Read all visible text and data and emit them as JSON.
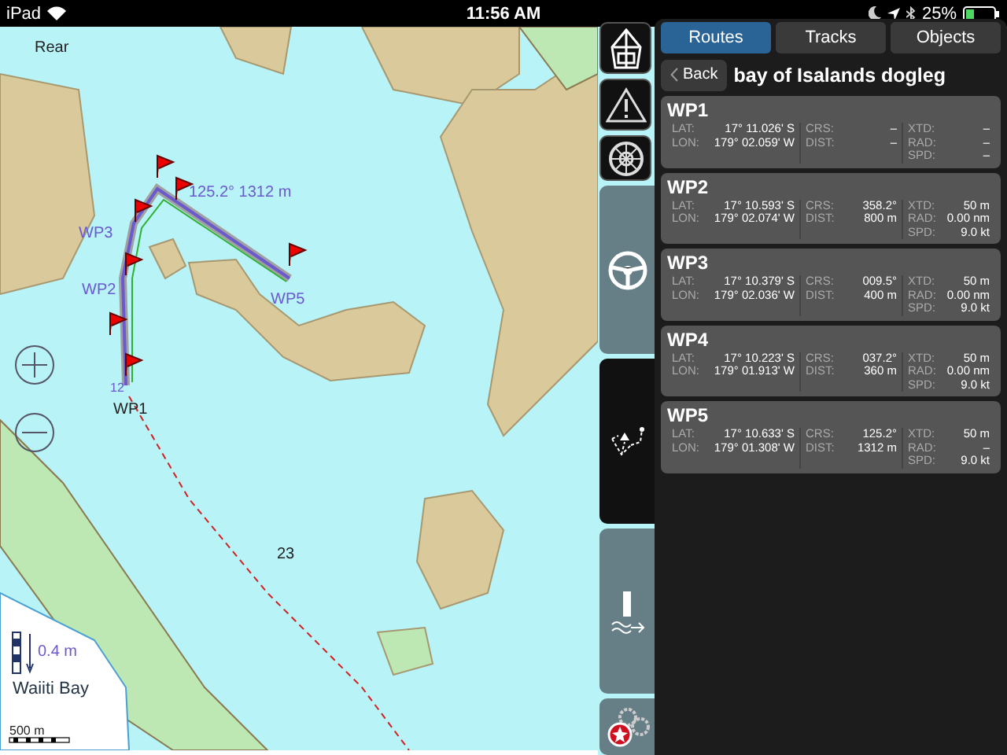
{
  "status_bar": {
    "device": "iPad",
    "time": "11:56 AM",
    "battery": "25%"
  },
  "map": {
    "labels": [
      "Rear",
      "125.2° 1312 m",
      "WP3",
      "WP2",
      "WP5",
      "12",
      "WP1",
      "23",
      "Waiiti Bay"
    ],
    "depth": "0.4 m",
    "scale": "500 m"
  },
  "toolbar": {
    "buttons": [
      {
        "kind": "ship",
        "selected": false
      },
      {
        "kind": "warning",
        "selected": false
      },
      {
        "kind": "wheel",
        "selected": false
      },
      {
        "kind": "helm",
        "selected": false
      },
      {
        "kind": "route",
        "selected": true
      },
      {
        "kind": "tide",
        "selected": false
      },
      {
        "kind": "settings",
        "selected": false
      }
    ]
  },
  "panel": {
    "tabs": [
      {
        "label": "Routes",
        "selected": true
      },
      {
        "label": "Tracks",
        "selected": false
      },
      {
        "label": "Objects",
        "selected": false
      }
    ],
    "back": "Back",
    "route_title": "bay of Isalands dogleg",
    "waypoints": [
      {
        "name": "WP1",
        "columns": [
          [
            {
              "label": "LAT:",
              "value": "17° 11.026' S"
            },
            {
              "label": "LON:",
              "value": "179° 02.059' W"
            }
          ],
          [
            {
              "label": "CRS:",
              "value": "–"
            },
            {
              "label": "DIST:",
              "value": "–"
            }
          ],
          [
            {
              "label": "XTD:",
              "value": "–"
            },
            {
              "label": "RAD:",
              "value": "–"
            },
            {
              "label": "SPD:",
              "value": "–"
            }
          ]
        ]
      },
      {
        "name": "WP2",
        "columns": [
          [
            {
              "label": "LAT:",
              "value": "17° 10.593' S"
            },
            {
              "label": "LON:",
              "value": "179° 02.074' W"
            }
          ],
          [
            {
              "label": "CRS:",
              "value": "358.2°"
            },
            {
              "label": "DIST:",
              "value": "800 m"
            }
          ],
          [
            {
              "label": "XTD:",
              "value": "50 m"
            },
            {
              "label": "RAD:",
              "value": "0.00 nm"
            },
            {
              "label": "SPD:",
              "value": "9.0 kt"
            }
          ]
        ]
      },
      {
        "name": "WP3",
        "columns": [
          [
            {
              "label": "LAT:",
              "value": "17° 10.379' S"
            },
            {
              "label": "LON:",
              "value": "179° 02.036' W"
            }
          ],
          [
            {
              "label": "CRS:",
              "value": "009.5°"
            },
            {
              "label": "DIST:",
              "value": "400 m"
            }
          ],
          [
            {
              "label": "XTD:",
              "value": "50 m"
            },
            {
              "label": "RAD:",
              "value": "0.00 nm"
            },
            {
              "label": "SPD:",
              "value": "9.0 kt"
            }
          ]
        ]
      },
      {
        "name": "WP4",
        "columns": [
          [
            {
              "label": "LAT:",
              "value": "17° 10.223' S"
            },
            {
              "label": "LON:",
              "value": "179° 01.913' W"
            }
          ],
          [
            {
              "label": "CRS:",
              "value": "037.2°"
            },
            {
              "label": "DIST:",
              "value": "360 m"
            }
          ],
          [
            {
              "label": "XTD:",
              "value": "50 m"
            },
            {
              "label": "RAD:",
              "value": "0.00 nm"
            },
            {
              "label": "SPD:",
              "value": "9.0 kt"
            }
          ]
        ]
      },
      {
        "name": "WP5",
        "columns": [
          [
            {
              "label": "LAT:",
              "value": "17° 10.633' S"
            },
            {
              "label": "LON:",
              "value": "179° 01.308' W"
            }
          ],
          [
            {
              "label": "CRS:",
              "value": "125.2°"
            },
            {
              "label": "DIST:",
              "value": "1312 m"
            }
          ],
          [
            {
              "label": "XTD:",
              "value": "50 m"
            },
            {
              "label": "RAD:",
              "value": "–"
            },
            {
              "label": "SPD:",
              "value": "9.0 kt"
            }
          ]
        ]
      }
    ]
  }
}
